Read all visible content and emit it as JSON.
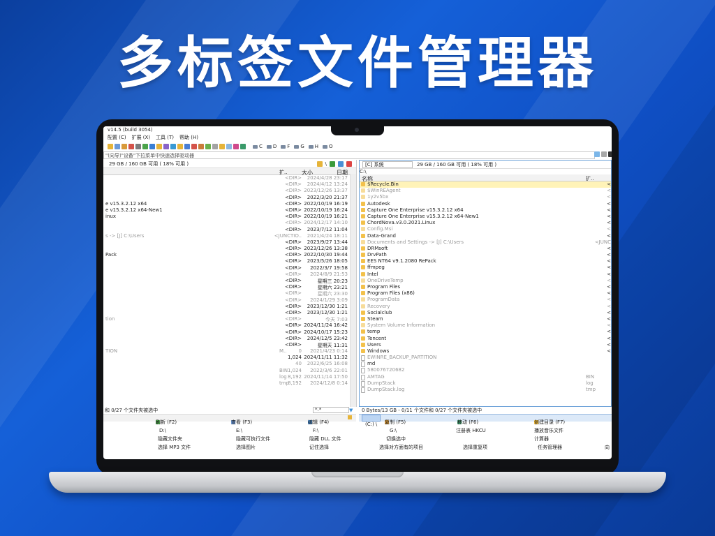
{
  "headline": "多标签文件管理器",
  "app": {
    "title": "v14.5 (build 3054)",
    "menu": [
      "配置 (C)",
      "扩展 (X)",
      "工具 (T)",
      "帮助 (H)"
    ],
    "drives": [
      "C",
      "D",
      "F",
      "G",
      "H",
      "O"
    ],
    "address_placeholder": "\"(向导)\"设备\"下拉菜单中快速选择驱动器",
    "left": {
      "space": "29 GB / 160 GB 可用 ( 18% 可用 )",
      "col_ext": "扩..",
      "col_size": "大小",
      "col_date": "日期",
      "rows": [
        {
          "name": "",
          "size": "<DIR>",
          "date": "2024/4/28 23:17",
          "dim": true
        },
        {
          "name": "",
          "size": "<DIR>",
          "date": "2024/4/12 13:24",
          "dim": true
        },
        {
          "name": "",
          "size": "<DIR>",
          "date": "2023/12/26 13:37",
          "dim": true
        },
        {
          "name": "",
          "size": "<DIR>",
          "date": "2022/3/20 21:37",
          "dim": false
        },
        {
          "name": "e v15.3.2.12 x64",
          "size": "<DIR>",
          "date": "2022/10/19 16:19",
          "dim": false
        },
        {
          "name": "e v15.3.2.12 x64-New1",
          "size": "<DIR>",
          "date": "2022/10/19 16:24",
          "dim": false
        },
        {
          "name": "inux",
          "size": "<DIR>",
          "date": "2022/10/19 16:21",
          "dim": false
        },
        {
          "name": "",
          "size": "<DIR>",
          "date": "2024/12/17 14:10",
          "dim": true
        },
        {
          "name": "",
          "size": "<DIR>",
          "date": "2023/7/12 11:04",
          "dim": false
        },
        {
          "name": "s -> [J] C:\\Users",
          "size": "<JUNCTIO..",
          "date": "2021/4/24 18:11",
          "dim": true
        },
        {
          "name": "",
          "size": "<DIR>",
          "date": "2023/9/27 13:44",
          "dim": false
        },
        {
          "name": "",
          "size": "<DIR>",
          "date": "2023/12/26 13:38",
          "dim": false
        },
        {
          "name": "Pack",
          "size": "<DIR>",
          "date": "2022/10/30 19:44",
          "dim": false
        },
        {
          "name": "",
          "size": "<DIR>",
          "date": "2023/5/26 18:05",
          "dim": false
        },
        {
          "name": "",
          "size": "<DIR>",
          "date": "2022/3/7 19:58",
          "dim": false
        },
        {
          "name": "",
          "size": "<DIR>",
          "date": "2024/8/9 21:53",
          "dim": true
        },
        {
          "name": "",
          "size": "<DIR>",
          "date": "星期三 20:23",
          "dim": false
        },
        {
          "name": "",
          "size": "<DIR>",
          "date": "星期六 23:21",
          "dim": false
        },
        {
          "name": "",
          "size": "<DIR>",
          "date": "星期六 23:30",
          "dim": true
        },
        {
          "name": "",
          "size": "<DIR>",
          "date": "2024/1/29 3:09",
          "dim": true
        },
        {
          "name": "",
          "size": "<DIR>",
          "date": "2023/12/30 1:21",
          "dim": false
        },
        {
          "name": "",
          "size": "<DIR>",
          "date": "2023/12/30 1:21",
          "dim": false
        },
        {
          "name": "tion",
          "size": "<DIR>",
          "date": "今天 7:03",
          "dim": true
        },
        {
          "name": "",
          "size": "<DIR>",
          "date": "2024/11/24 16:42",
          "dim": false
        },
        {
          "name": "",
          "size": "<DIR>",
          "date": "2024/10/17 15:23",
          "dim": false
        },
        {
          "name": "",
          "size": "<DIR>",
          "date": "2024/12/5 23:42",
          "dim": false
        },
        {
          "name": "",
          "size": "<DIR>",
          "date": "星期天 11:31",
          "dim": false
        },
        {
          "name": "TION",
          "ext": "M..",
          "size": "0",
          "date": "2021/4/23 0:14",
          "dim": true
        },
        {
          "name": "",
          "size": "1,024",
          "date": "2024/11/11 11:32",
          "dim": false
        },
        {
          "name": "",
          "size": "40",
          "date": "2022/6/25 16:08",
          "dim": true
        },
        {
          "name": "",
          "ext": "BIN",
          "size": "1,024",
          "date": "2022/3/6 22:01",
          "dim": true
        },
        {
          "name": "",
          "ext": "log",
          "size": "8,192",
          "date": "2024/11/14 17:50",
          "dim": true
        },
        {
          "name": "",
          "ext": "tmp",
          "size": "8,192",
          "date": "2024/12/8 0:14",
          "dim": true
        }
      ],
      "status": "和 0/27 个文件夹被选中",
      "filter": "*.*"
    },
    "right": {
      "drive_label": "[C] 系统",
      "space": "29 GB / 160 GB 可用 ( 18% 可用 )",
      "path": "C:\\",
      "col_name": "名称",
      "col_ext": "扩..",
      "rows": [
        {
          "name": "$Recycle.Bin",
          "dim": false,
          "sel": true,
          "right": "<"
        },
        {
          "name": "$WinREAgent",
          "dim": true,
          "right": "<"
        },
        {
          "name": "1y2v5bx",
          "dim": true,
          "right": "<"
        },
        {
          "name": "Autodesk",
          "dim": false,
          "right": "<"
        },
        {
          "name": "Capture One Enterprise v15.3.2.12 x64",
          "dim": false,
          "right": "<"
        },
        {
          "name": "Capture One Enterprise v15.3.2.12 x64-New1",
          "dim": false,
          "right": "<"
        },
        {
          "name": "ChordNova.v3.0.2021.Linux",
          "dim": false,
          "right": "<"
        },
        {
          "name": "Config.Msi",
          "dim": true,
          "right": "<"
        },
        {
          "name": "Data-Grand",
          "dim": false,
          "right": "<"
        },
        {
          "name": "Documents and Settings -> [J] C:\\Users",
          "dim": true,
          "right": "<JUNC"
        },
        {
          "name": "DRMsoft",
          "dim": false,
          "right": "<"
        },
        {
          "name": "DrvPath",
          "dim": false,
          "right": "<"
        },
        {
          "name": "EES NT64 v9.1.2080 RePack",
          "dim": false,
          "right": "<"
        },
        {
          "name": "ffmpeg",
          "dim": false,
          "right": "<"
        },
        {
          "name": "Intel",
          "dim": false,
          "right": "<"
        },
        {
          "name": "OneDriveTemp",
          "dim": true,
          "right": "<"
        },
        {
          "name": "Program Files",
          "dim": false,
          "right": "<"
        },
        {
          "name": "Program Files (x86)",
          "dim": false,
          "right": "<"
        },
        {
          "name": "ProgramData",
          "dim": true,
          "right": "<"
        },
        {
          "name": "Recovery",
          "dim": true,
          "right": "<"
        },
        {
          "name": "Socialclub",
          "dim": false,
          "right": "<"
        },
        {
          "name": "Steam",
          "dim": false,
          "right": "<"
        },
        {
          "name": "System Volume Information",
          "dim": true,
          "right": "<"
        },
        {
          "name": "temp",
          "dim": false,
          "right": "<"
        },
        {
          "name": "Tencent",
          "dim": false,
          "right": "<"
        },
        {
          "name": "Users",
          "dim": false,
          "right": "<"
        },
        {
          "name": "Windows",
          "dim": false,
          "right": "<"
        },
        {
          "name": "EWINRE_BACKUP_PARTITION",
          "dim": true,
          "file": true,
          "right": ""
        },
        {
          "name": "md",
          "dim": false,
          "file": true,
          "right": ""
        },
        {
          "name": "580076720682",
          "dim": true,
          "file": true,
          "right": ""
        },
        {
          "name": "AMTAG",
          "dim": true,
          "file": true,
          "ext": "BIN",
          "right": ""
        },
        {
          "name": "DumpStack",
          "dim": true,
          "file": true,
          "ext": "log",
          "right": ""
        },
        {
          "name": "DumpStack.log",
          "dim": true,
          "file": true,
          "ext": "tmp",
          "right": ""
        }
      ],
      "status": "0 Bytes/13 GB - 0/11 个文件和 0/27 个文件夹被选中",
      "tab": "(C:) \\"
    },
    "fn_row1": [
      "刷新 (F2)",
      "查看 (F3)",
      "编辑 (F4)",
      "复制 (F5)",
      "移动 (F6)",
      "创建目录 (F7)"
    ],
    "fn_row2": [
      "D:\\",
      "E:\\",
      "F:\\",
      "G:\\",
      "注册表 HKCU",
      "播放音乐文件"
    ],
    "fn_row3": [
      "隐藏文件夹",
      "隐藏可执行文件",
      "隐藏 DLL 文件",
      "切换选中",
      "计算器"
    ],
    "fn_row4": [
      "选择 MP3 文件",
      "选择图片",
      "记住选择",
      "选择对方面有的项目",
      "选择重复项",
      "任务管理器",
      "向"
    ]
  }
}
